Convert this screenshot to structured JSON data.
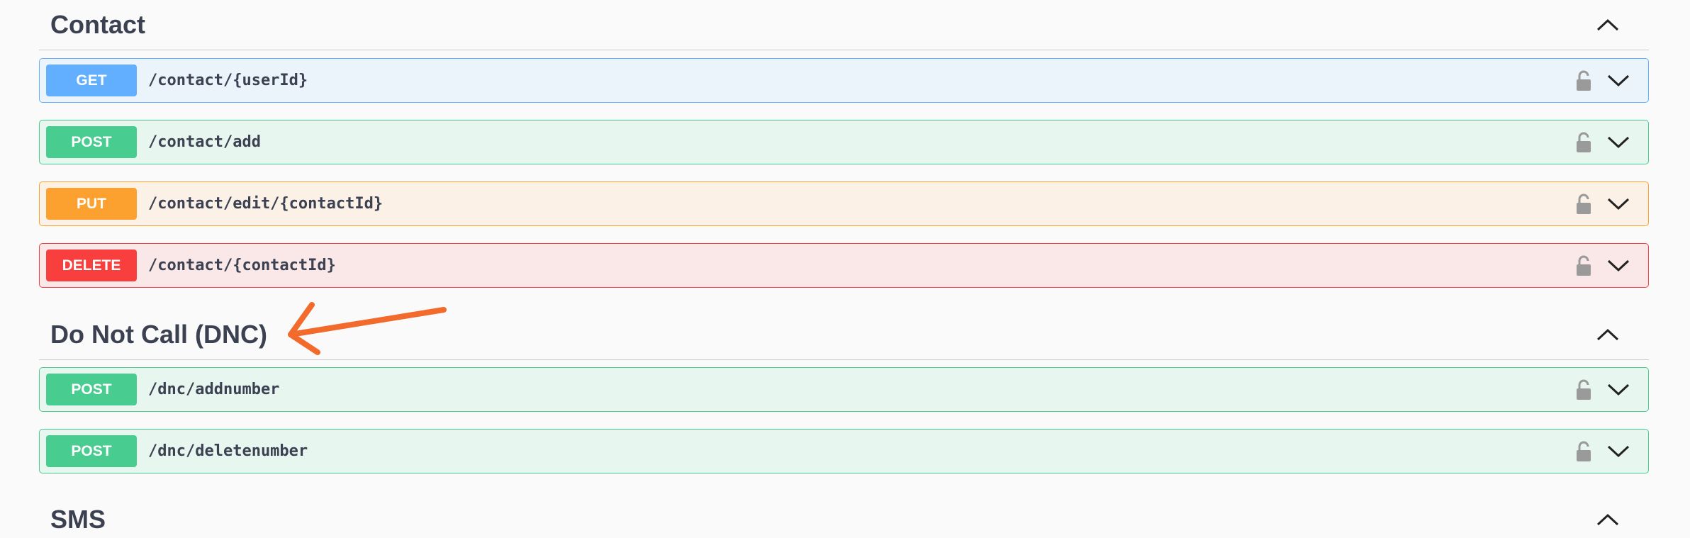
{
  "sections": [
    {
      "title": "Contact",
      "operations": [
        {
          "method": "GET",
          "path": "/contact/{userId}"
        },
        {
          "method": "POST",
          "path": "/contact/add"
        },
        {
          "method": "PUT",
          "path": "/contact/edit/{contactId}"
        },
        {
          "method": "DELETE",
          "path": "/contact/{contactId}"
        }
      ]
    },
    {
      "title": "Do Not Call (DNC)",
      "operations": [
        {
          "method": "POST",
          "path": "/dnc/addnumber"
        },
        {
          "method": "POST",
          "path": "/dnc/deletenumber"
        }
      ]
    },
    {
      "title": "SMS",
      "operations": []
    }
  ],
  "icons": {
    "section_toggle": "chevron-up-icon",
    "operation_lock": "lock-icon",
    "operation_expand": "chevron-down-icon",
    "annotation": "orange-arrow-icon"
  },
  "colors": {
    "get": "#61affe",
    "post": "#49cc90",
    "put": "#fca130",
    "delete": "#f93e3e",
    "annotation_arrow": "#f26b2c"
  }
}
